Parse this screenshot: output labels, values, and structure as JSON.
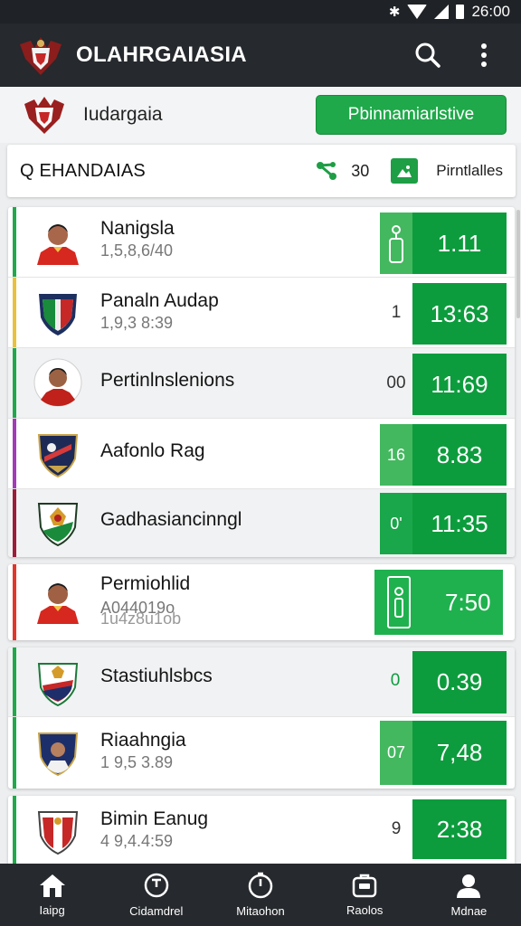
{
  "status_bar": {
    "time": "26:00",
    "icons": [
      "bluetooth-icon",
      "wifi-icon",
      "signal-icon",
      "battery-icon"
    ]
  },
  "app": {
    "title": "OLAHRGAIASIA",
    "icons": [
      "crest-logo-icon",
      "search-icon",
      "more-vert-icon"
    ]
  },
  "league": {
    "name": "Iudargaia",
    "button_label": "Pbinnamiarlstive"
  },
  "filter": {
    "search_label": "Q EHANDAIAS",
    "count": "30",
    "label": "Pirntlalles",
    "icons": [
      "flow-icon",
      "image-icon"
    ]
  },
  "rows": [
    {
      "name": "Nanigsla",
      "sub": "1,5,8,6/40",
      "rank": "",
      "score": "1.11",
      "accent": "#1fa94a",
      "avatar": "player-red-icon"
    },
    {
      "name": "Panaln Audap",
      "sub": "1,9,3 8:39",
      "rank": "1",
      "score": "13:63",
      "accent": "#e9c13c",
      "avatar": "crest-green-red-icon"
    },
    {
      "name": "Pertinlnslenions",
      "sub": "",
      "rank": "00",
      "score": "11:69",
      "accent": "#1fa94a",
      "avatar": "player-round-icon"
    },
    {
      "name": "Aafonlo Rag",
      "sub": "",
      "rank": "16",
      "score": "8.83",
      "accent": "#a23bb5",
      "avatar": "crest-navy-icon"
    },
    {
      "name": "Gadhasianсinngl",
      "sub": "",
      "rank": "0'",
      "score": "11:35",
      "accent": "#9c1c3a",
      "avatar": "crest-garuda-icon"
    },
    {
      "name": "Permiohlid",
      "sub": "А044019о",
      "sub2": "1u4z8u1ob",
      "rank": "",
      "score": "7:50",
      "accent": "#e2362a",
      "avatar": "player-red-icon"
    },
    {
      "name": "Stastiuhlsbcs",
      "sub": "",
      "rank": "0",
      "score": "0.39",
      "accent": "#1fa94a",
      "avatar": "crest-flag-icon"
    },
    {
      "name": "Riaahngia",
      "sub": "1 9,5 3.89",
      "rank": "07",
      "score": "7,48",
      "accent": "#1fa94a",
      "avatar": "crest-player-icon"
    },
    {
      "name": "Bimin Eanug",
      "sub": "4 9,4.4:59",
      "rank": "9",
      "score": "2:38",
      "accent": "#1fa94a",
      "avatar": "crest-red-white-icon"
    }
  ],
  "nav": [
    {
      "label": "Iaipg",
      "icon": "home-icon"
    },
    {
      "label": "Cidamdrel",
      "icon": "clock-icon"
    },
    {
      "label": "Mitaohon",
      "icon": "stopwatch-icon"
    },
    {
      "label": "Raolos",
      "icon": "briefcase-icon"
    },
    {
      "label": "Mdnae",
      "icon": "profile-icon"
    }
  ],
  "colors": {
    "accent_green": "#1fa94a",
    "score_green": "#0d9c3d",
    "appbar": "#26292d"
  }
}
